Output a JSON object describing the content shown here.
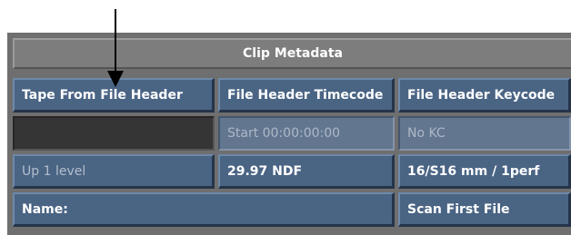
{
  "panel": {
    "title": "Clip Metadata"
  },
  "row1": {
    "tape_from_file_header": "Tape From File Header",
    "file_header_timecode": "File Header Timecode",
    "file_header_keycode": "File Header Keycode"
  },
  "row2": {
    "tape_value": "",
    "start_timecode": "Start 00:00:00:00",
    "keycode_value": "No KC"
  },
  "row3": {
    "up_level": "Up 1 level",
    "frame_rate": "29.97 NDF",
    "film_format": "16/S16 mm / 1perf"
  },
  "row4": {
    "name_label": "Name:",
    "scan_first_file": "Scan First File"
  }
}
